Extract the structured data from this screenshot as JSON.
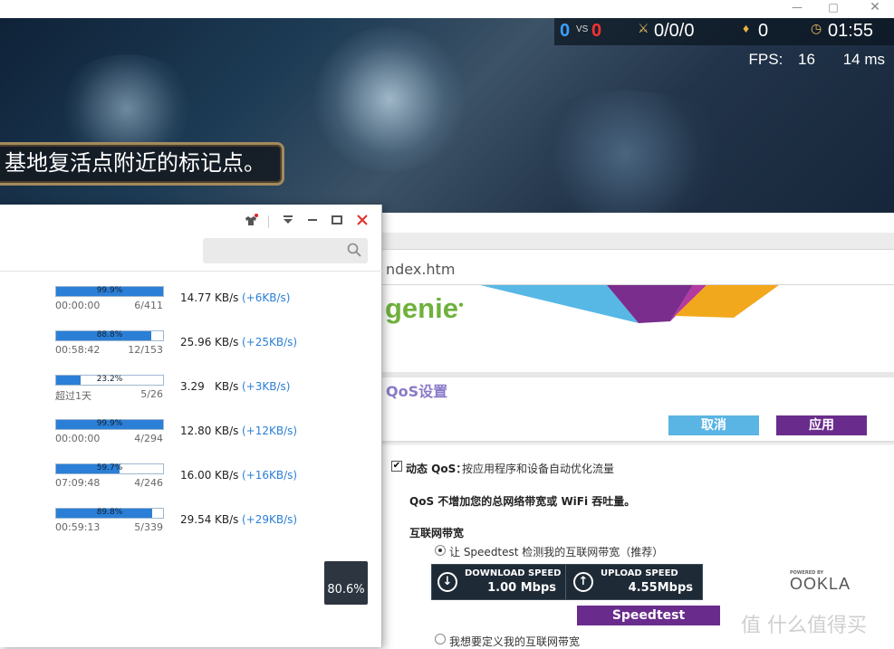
{
  "window": {
    "minimize": "—",
    "maximize": "□",
    "close": "✕"
  },
  "game": {
    "score_blue": "0",
    "vs": "VS",
    "score_red": "0",
    "kda": "0/0/0",
    "gold": "0",
    "timer": "01:55",
    "fps_label": "FPS:",
    "fps_value": "16",
    "ping": "14 ms",
    "hint": "基地复活点附近的标记点。"
  },
  "router": {
    "address": "ndex.htm",
    "logo": "genie",
    "section_title": "QoS设置",
    "cancel": "取消",
    "apply": "应用",
    "dynamic_qos_label": "动态 QoS：",
    "dynamic_qos_desc": "按应用程序和设备自动优化流量",
    "qos_note": "QoS 不增加您的总网络带宽或 WiFi 吞吐量。",
    "bandwidth_title": "互联网带宽",
    "radio_speedtest": "让 Speedtest 检测我的互联网带宽（推荐）",
    "download_label": "DOWNLOAD SPEED",
    "download_value": "1.00 Mbps",
    "upload_label": "UPLOAD SPEED",
    "upload_value": "4.55Mbps",
    "speedtest_button": "Speedtest",
    "ookla_powered": "POWERED BY",
    "ookla": "OOKLA",
    "radio_custom": "我想要定义我的互联网带宽"
  },
  "monitor": {
    "rows": [
      {
        "percent": "99.9%",
        "fill": 0.999,
        "time": "00:00:00",
        "count": "6/411",
        "speed": "14.77",
        "unit": "KB/s",
        "delta": "(+6KB/s)"
      },
      {
        "percent": "88.8%",
        "fill": 0.888,
        "time": "00:58:42",
        "count": "12/153",
        "speed": "25.96",
        "unit": "KB/s",
        "delta": "(+25KB/s)"
      },
      {
        "percent": "23.2%",
        "fill": 0.232,
        "time": "超过1天",
        "count": "5/26",
        "speed": "3.29",
        "unit": "KB/s",
        "delta": "(+3KB/s)"
      },
      {
        "percent": "99.9%",
        "fill": 0.999,
        "time": "00:00:00",
        "count": "4/294",
        "speed": "12.80",
        "unit": "KB/s",
        "delta": "(+12KB/s)"
      },
      {
        "percent": "59.7%",
        "fill": 0.597,
        "time": "07:09:48",
        "count": "4/246",
        "speed": "16.00",
        "unit": "KB/s",
        "delta": "(+16KB/s)"
      },
      {
        "percent": "89.8%",
        "fill": 0.898,
        "time": "00:59:13",
        "count": "5/339",
        "speed": "29.54",
        "unit": "KB/s",
        "delta": "(+29KB/s)"
      }
    ],
    "overall": "80.6%"
  },
  "watermark": "值 什么值得买",
  "colors": {
    "accent_purple": "#6a2c8c",
    "accent_blue": "#5ab4e4",
    "bar_blue": "#2b7fd6",
    "genie_green": "#6eb13c"
  }
}
